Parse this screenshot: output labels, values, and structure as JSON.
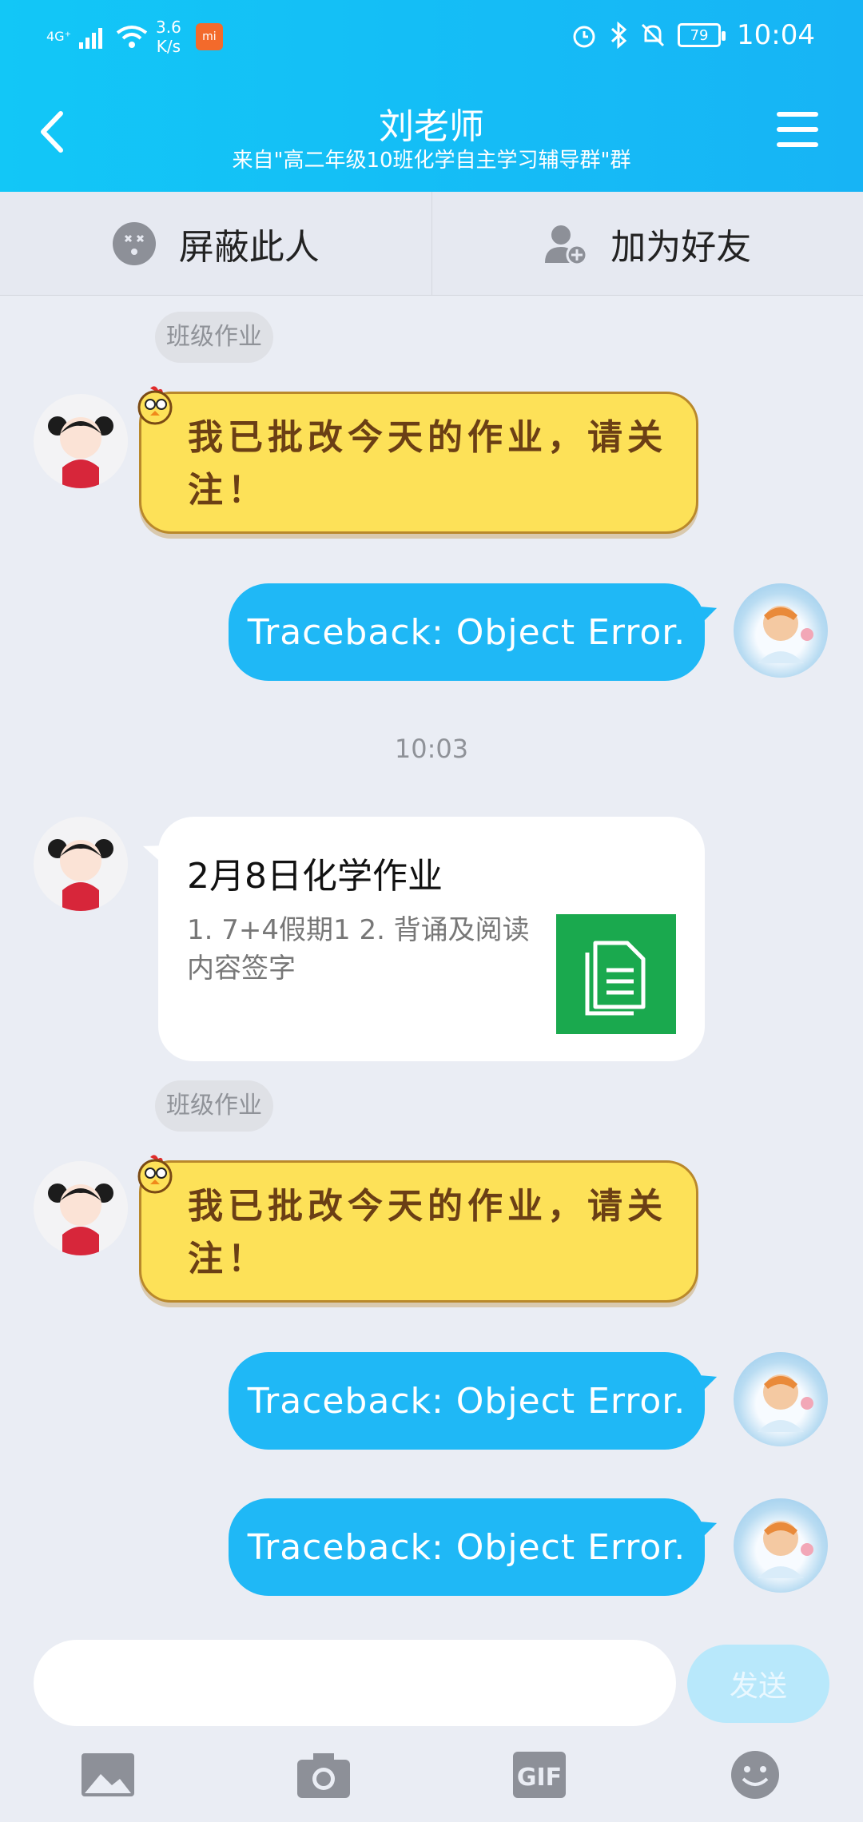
{
  "status_bar": {
    "network": "4G⁺",
    "speed_value": "3.6",
    "speed_unit": "K/s",
    "battery": "79",
    "time": "10:04"
  },
  "header": {
    "title": "刘老师",
    "subtitle": "来自\"高二年级10班化学自主学习辅导群\"群"
  },
  "actions": {
    "block": "屏蔽此人",
    "add_friend": "加为好友"
  },
  "messages": {
    "tag1": "班级作业",
    "yellow1_line1": "我已批改今天的作业，请关",
    "yellow1_line2": "注！",
    "blue1": "Traceback: Object Error.",
    "timestamp": "10:03",
    "card_title": "2月8日化学作业",
    "card_desc": "1. 7+4假期1   2. 背诵及阅读内容签字",
    "tag2": "班级作业",
    "yellow2_line1": "我已批改今天的作业，请关",
    "yellow2_line2": "注！",
    "blue2": "Traceback: Object Error.",
    "blue3": "Traceback: Object Error."
  },
  "input": {
    "send": "发送"
  },
  "colors": {
    "header": "#17b4f5",
    "blue_bubble": "#1fb8f6",
    "yellow_bubble": "#fde158",
    "card_icon": "#1aa94e"
  },
  "toolbar_icons": [
    "image-icon",
    "camera-icon",
    "gif-icon",
    "emoji-icon"
  ]
}
